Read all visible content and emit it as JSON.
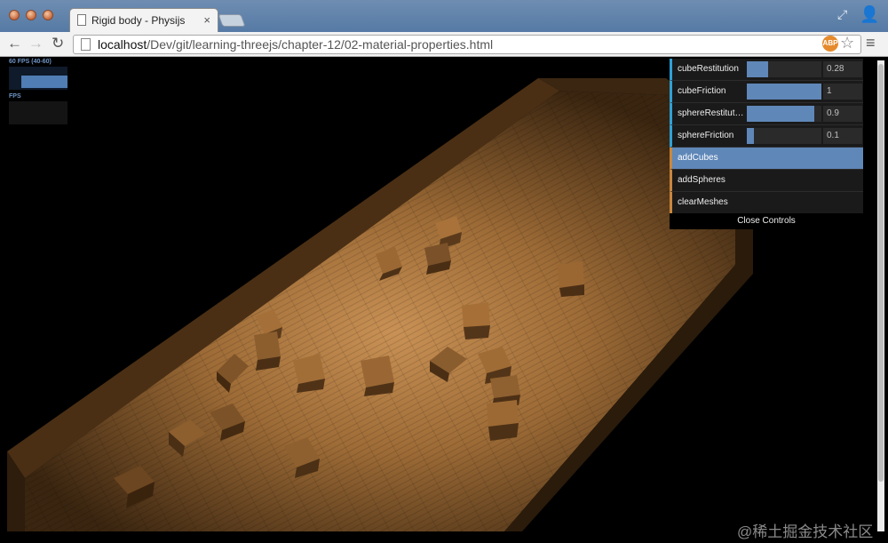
{
  "browser": {
    "tab_title": "Rigid body - Physijs",
    "tab_close": "×",
    "url_host": "localhost",
    "url_path": "/Dev/git/learning-threejs/chapter-12/02-material-properties.html",
    "icons": {
      "back": "←",
      "forward": "→",
      "reload": "↻",
      "star": "☆",
      "menu": "≡",
      "resize": "⤢",
      "incognito": "👤"
    },
    "ext_badge": "ABP"
  },
  "stats": {
    "fps_label": "60 FPS (40-60)",
    "mode_label": "FPS"
  },
  "gui": {
    "controls": [
      {
        "label": "cubeRestitution",
        "value": "0.28",
        "fill": 0.28
      },
      {
        "label": "cubeFriction",
        "value": "1",
        "fill": 1.0
      },
      {
        "label": "sphereRestitution",
        "value": "0.9",
        "fill": 0.9
      },
      {
        "label": "sphereFriction",
        "value": "0.1",
        "fill": 0.1
      }
    ],
    "buttons": [
      {
        "label": "addCubes"
      },
      {
        "label": "addSpheres"
      },
      {
        "label": "clearMeshes"
      }
    ],
    "close_label": "Close Controls"
  },
  "watermark": "@稀土掘金技术社区",
  "colors": {
    "accent": "#5f87b8",
    "wood": "#b07a3c"
  }
}
